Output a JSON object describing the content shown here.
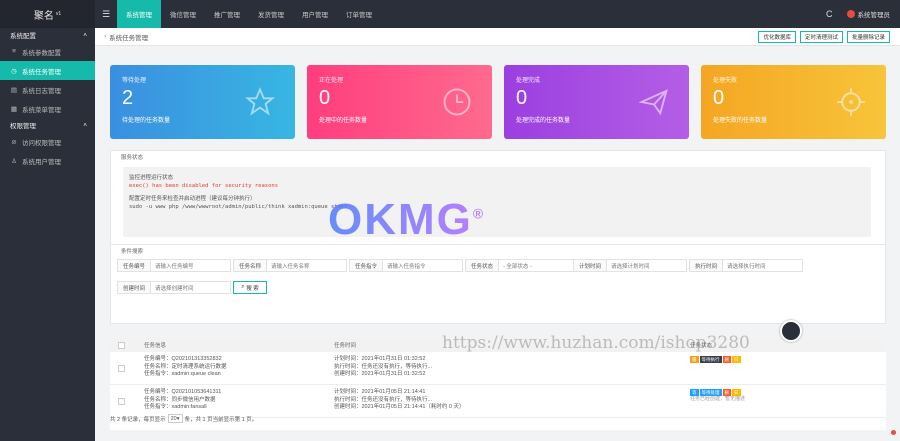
{
  "topbar": {
    "logo": "聚名",
    "logo_sup": "v1",
    "menu_icon": "☰",
    "tabs": [
      "系统管理",
      "微信管理",
      "推广管理",
      "发货管理",
      "用户管理",
      "订单管理"
    ],
    "refresh_icon": "C",
    "user": "系统管理员"
  },
  "sidebar": {
    "groups": [
      {
        "label": "系统配置",
        "items": [
          "系统参数配置",
          "系统任务管理",
          "系统日志管理",
          "系统菜单管理"
        ]
      },
      {
        "label": "权限管理",
        "items": [
          "访问权限管理",
          "系统用户管理"
        ]
      }
    ]
  },
  "breadcrumb": "系统任务管理",
  "actions": [
    "优化数据库",
    "定时清理测试",
    "批量删除记录"
  ],
  "cards": [
    {
      "title": "等待处理",
      "num": "2",
      "desc": "待处理的任务数量",
      "icon": "star-icon"
    },
    {
      "title": "正在处理",
      "num": "0",
      "desc": "处理中的任务数量",
      "icon": "clock-icon"
    },
    {
      "title": "处理完成",
      "num": "0",
      "desc": "处理完成的任务数量",
      "icon": "paper-plane-icon"
    },
    {
      "title": "处理失败",
      "num": "0",
      "desc": "处理失败的任务数量",
      "icon": "virus-icon"
    }
  ],
  "status": {
    "title": "服务状态",
    "line1": "监控进程运行状态",
    "line2": "exec() has been disabled for security reasons",
    "line3": "配置定时任务来检查并启动进程（建议每分钟执行）",
    "line4": "sudo -u www php /www/wwwroot/admin/public/think xadmin:queue start"
  },
  "search": {
    "title": "条件搜索",
    "fields": [
      {
        "label": "任务编号",
        "placeholder": "请输入任务编号"
      },
      {
        "label": "任务名称",
        "placeholder": "请输入任务名称"
      },
      {
        "label": "任务指令",
        "placeholder": "请输入任务指令"
      },
      {
        "label": "任务状态",
        "placeholder": "- 全部状态 -"
      },
      {
        "label": "计划时间",
        "placeholder": "请选择计划时间"
      },
      {
        "label": "执行时间",
        "placeholder": "请选择执行时间"
      },
      {
        "label": "创建时间",
        "placeholder": "请选择创建时间"
      }
    ],
    "button": "搜 索"
  },
  "table": {
    "headers": [
      "任务信息",
      "任务时间",
      "任务状态"
    ],
    "rows": [
      {
        "code": "任务编号：Q202101313352832",
        "name": "任务名称：定时清理系统运行数据",
        "cmd": "任务指令：xadmin:queue clean",
        "plan": "计划时间：2021年01月31日 01:32:52",
        "exec": "执行时间：任务还没有执行，等待执行...",
        "create": "创建时间：2021年01月31日 01:32:52",
        "tags": [
          "循",
          "等待执行",
          "删",
          "日"
        ],
        "note": ""
      },
      {
        "code": "任务编号：Q202101053641311",
        "name": "任务名称：同步微信用户数据",
        "cmd": "任务指令：xadmin:fansall",
        "plan": "计划时间：2021年01月05日 21:14:41",
        "exec": "执行时间：任务还没有执行，等待执行...",
        "create": "创建时间：2021年01月05日 21:14:41（耗时约 0 天）",
        "tags": [
          "等",
          "等待处理",
          "删",
          "日"
        ],
        "note": "任务已经创建，暂无描述"
      }
    ]
  },
  "pager": {
    "text1": "共 2 条记录，每页显示",
    "size": "20",
    "text2": "条，共 1 页当前显示第 1 页。"
  },
  "watermark": {
    "logo": "OKMG",
    "reg": "®",
    "url": "https://www.huzhan.com/ishop3280"
  }
}
